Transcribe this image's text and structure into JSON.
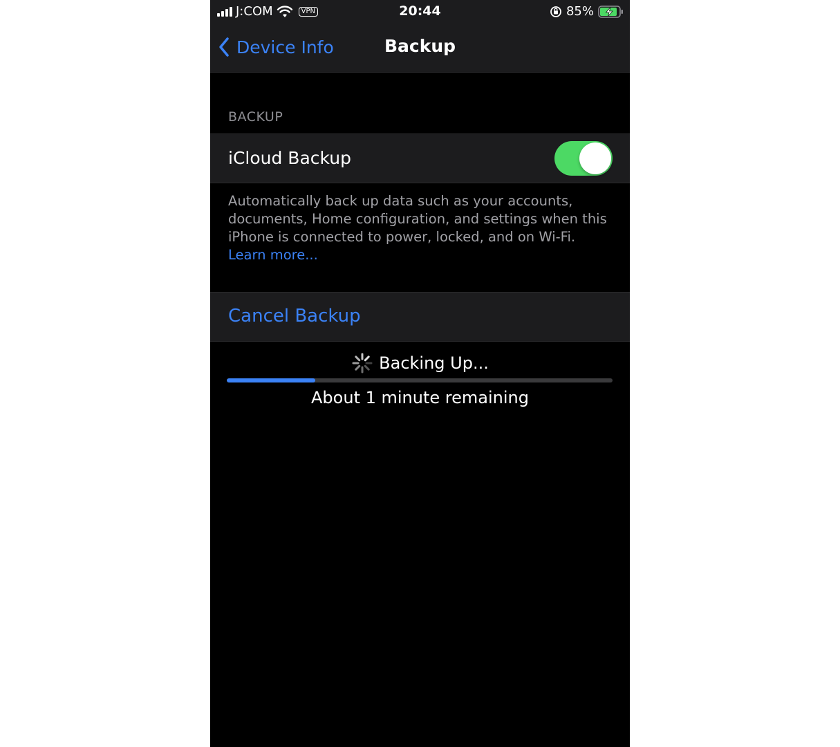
{
  "status_bar": {
    "carrier": "J:COM",
    "vpn": "VPN",
    "time": "20:44",
    "battery": "85%",
    "icons": [
      "signal-icon",
      "wifi-icon",
      "orientation-lock-icon",
      "battery-charging-icon"
    ]
  },
  "nav": {
    "back_label": "Device Info",
    "title": "Backup"
  },
  "backup_section": {
    "header": "BACKUP",
    "icloud_label": "iCloud Backup",
    "icloud_enabled": true,
    "footer": "Automatically back up data such as your accounts, documents, Home configuration, and settings when this iPhone is connected to power, locked, and on Wi-Fi.",
    "learn_more": "Learn more..."
  },
  "cancel": {
    "label": "Cancel Backup"
  },
  "progress": {
    "status": "Backing Up...",
    "fraction": 0.23,
    "remaining": "About 1 minute remaining"
  },
  "colors": {
    "accent": "#3b82f6",
    "toggle_on": "#4cd964",
    "background": "#000000",
    "cell": "#1c1c1e"
  }
}
